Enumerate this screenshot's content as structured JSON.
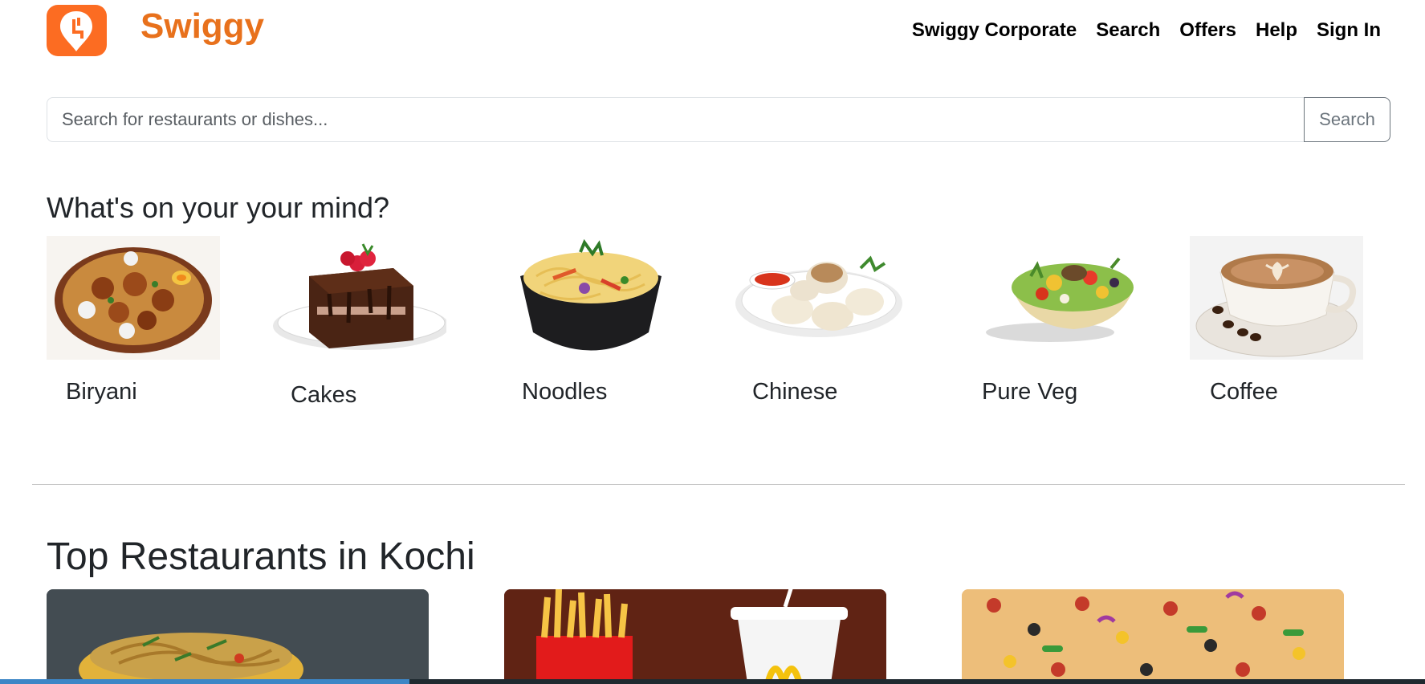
{
  "brand": {
    "name": "Swiggy",
    "color": "#e8711c",
    "logo_icon": "swiggy-pin-logo"
  },
  "nav": {
    "links": [
      {
        "label": "Swiggy Corporate"
      },
      {
        "label": "Search"
      },
      {
        "label": "Offers"
      },
      {
        "label": "Help"
      },
      {
        "label": "Sign In"
      }
    ]
  },
  "search": {
    "placeholder": "Search for restaurants or dishes...",
    "button_label": "Search"
  },
  "categories": {
    "heading": "What's on your your mind?",
    "items": [
      {
        "label": "Biryani",
        "icon": "biryani-plate"
      },
      {
        "label": "Cakes",
        "icon": "chocolate-cake"
      },
      {
        "label": "Noodles",
        "icon": "noodles-bowl"
      },
      {
        "label": "Chinese",
        "icon": "momos-plate"
      },
      {
        "label": "Pure Veg",
        "icon": "salad-bowl"
      },
      {
        "label": "Coffee",
        "icon": "coffee-cup"
      }
    ]
  },
  "top_restaurants": {
    "heading": "Top Restaurants in Kochi",
    "cards": [
      {
        "image": "noodles-photo"
      },
      {
        "image": "fries-and-drink-photo"
      },
      {
        "image": "pizza-photo"
      }
    ]
  }
}
